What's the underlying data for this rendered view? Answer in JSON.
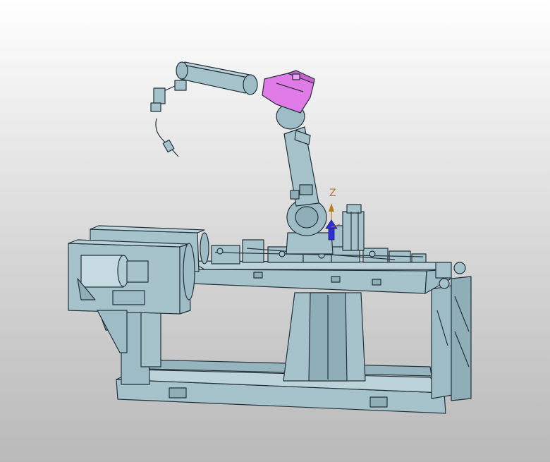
{
  "viewport": {
    "background_top": "#ffffff",
    "background_bottom": "#b9b9b9"
  },
  "model": {
    "body_color": "#a6c3cc",
    "shadow_color": "#7f9fa9",
    "highlight_color": "#e07ae6",
    "edge_color": "#23323a"
  },
  "triad": {
    "z_label": "Z",
    "z_axis_color": "#2f2fd8",
    "label_color": "#b87a1e"
  }
}
